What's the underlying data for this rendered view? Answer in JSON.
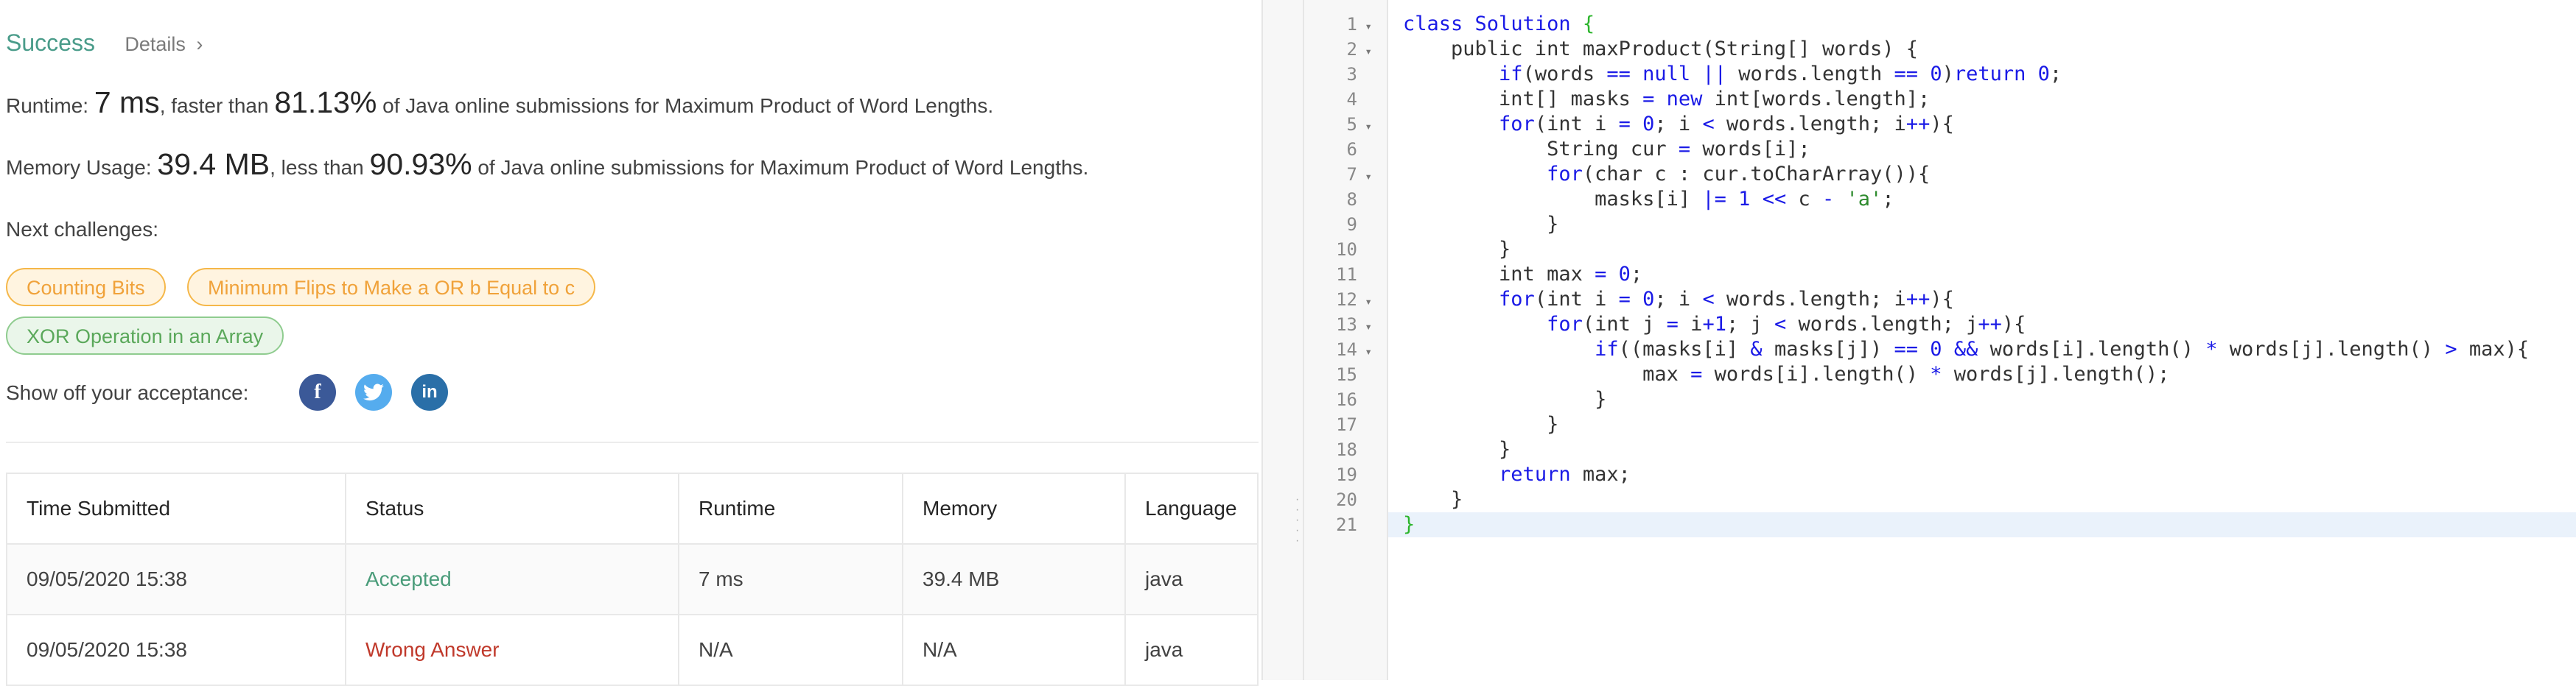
{
  "result": {
    "status": "Success",
    "details_label": "Details",
    "details_chevron": "›",
    "runtime": {
      "prefix": "Runtime: ",
      "value": "7 ms",
      "mid": ", faster than ",
      "percent": "81.13%",
      "suffix": " of Java online submissions for Maximum Product of Word Lengths."
    },
    "memory": {
      "prefix": "Memory Usage: ",
      "value": "39.4 MB",
      "mid": ", less than ",
      "percent": "90.93%",
      "suffix": " of Java online submissions for Maximum Product of Word Lengths."
    }
  },
  "challenges": {
    "label": "Next challenges:",
    "tags": [
      {
        "label": "Counting Bits",
        "color": "#f0a23a"
      },
      {
        "label": "Minimum Flips to Make a OR b Equal to c",
        "color": "#f0a23a"
      },
      {
        "label": "XOR Operation in an Array",
        "color": "#5aa85a"
      }
    ]
  },
  "share": {
    "label": "Show off your acceptance:",
    "buttons": [
      {
        "icon": "facebook-icon",
        "glyph": "f",
        "color": "#3b5998"
      },
      {
        "icon": "twitter-icon",
        "glyph": "t",
        "color": "#55acee"
      },
      {
        "icon": "linkedin-icon",
        "glyph": "in",
        "color": "#2a6fa8"
      }
    ]
  },
  "submissions": {
    "headers": [
      "Time Submitted",
      "Status",
      "Runtime",
      "Memory",
      "Language"
    ],
    "rows": [
      {
        "time": "09/05/2020 15:38",
        "status": "Accepted",
        "runtime": "7 ms",
        "memory": "39.4 MB",
        "language": "java"
      },
      {
        "time": "09/05/2020 15:38",
        "status": "Wrong Answer",
        "runtime": "N/A",
        "memory": "N/A",
        "language": "java"
      }
    ]
  },
  "editor": {
    "line_numbers": [
      "1",
      "2",
      "3",
      "4",
      "5",
      "6",
      "7",
      "8",
      "9",
      "10",
      "11",
      "12",
      "13",
      "14",
      "15",
      "16",
      "17",
      "18",
      "19",
      "20",
      "21"
    ],
    "fold_marker": "▾",
    "active_line": 21,
    "lines": [
      "class Solution {",
      "    public int maxProduct(String[] words) {",
      "        if(words == null || words.length == 0)return 0;",
      "        int[] masks = new int[words.length];",
      "        for(int i = 0; i < words.length; i++){",
      "            String cur = words[i];",
      "            for(char c : cur.toCharArray()){",
      "                masks[i] |= 1 << c - 'a';",
      "            }",
      "        }",
      "        int max = 0;",
      "        for(int i = 0; i < words.length; i++){",
      "            for(int j = i+1; j < words.length; j++){",
      "                if((masks[i] & masks[j]) == 0 && words[i].length() * words[j].length() > max){",
      "                    max = words[i].length() * words[j].length();",
      "                }",
      "            }",
      "        }",
      "        return max;",
      "    }",
      "}"
    ]
  }
}
